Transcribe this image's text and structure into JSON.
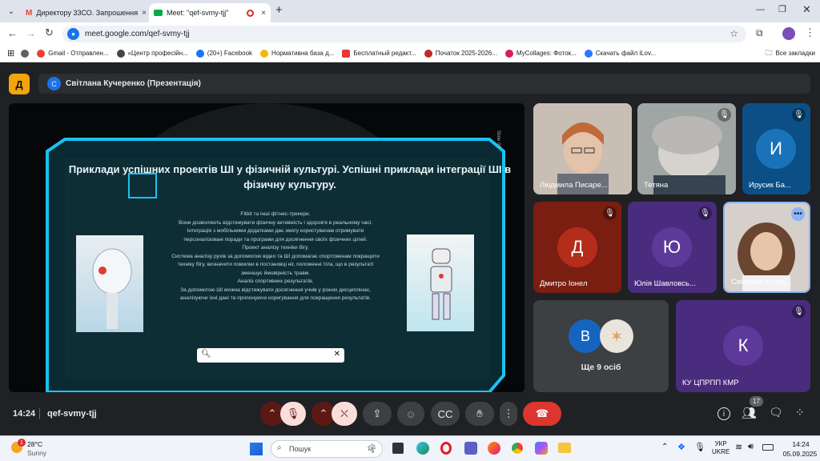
{
  "browser": {
    "tabs": [
      {
        "label": "Директору 33СО. Запрошення",
        "icon": "gmail-icon"
      },
      {
        "label": "Meet: \"qef-svmy-tjj\"",
        "icon": "meet-icon"
      }
    ],
    "new_tab": "+",
    "url": "meet.google.com/qef-svmy-tjj",
    "profile_initial": "K",
    "bookmarks": [
      {
        "label": "Gmail - Отправлен...",
        "color": "#ea4335"
      },
      {
        "label": "«Центр професійн...",
        "color": "#444444"
      },
      {
        "label": "(20+) Facebook",
        "color": "#1877f2"
      },
      {
        "label": "Нормативна база д...",
        "color": "#f2b90c"
      },
      {
        "label": "Бесплатный редакт...",
        "color": "#e53935"
      },
      {
        "label": "Початок 2025-2026...",
        "color": "#c62828"
      },
      {
        "label": "MyCollages: Фоток...",
        "color": "#d81b60"
      },
      {
        "label": "Скачать файл iLov...",
        "color": "#2979ff"
      }
    ],
    "all_bookmarks": "Все закладки"
  },
  "meet": {
    "logo_letter": "Д",
    "presenter_initial": "С",
    "presenter_title": "Світлана Кучеренко (Презентація)",
    "time": "14:24",
    "code": "qef-svmy-tjj",
    "people_count": "17",
    "colors": {
      "hangup": "#dc362e",
      "muted": "#f9dedc",
      "accent": "#8ab4f8"
    }
  },
  "slide": {
    "side_label": "Slide 08",
    "title": "Приклади успішних проектів ШІ у фізичній культурі. Успішні приклади інтеграції ШІ в фізичну культуру.",
    "paragraphs": [
      "Fitbit та інші фітнес-трекери.",
      "Вони дозволяють відстежувати фізичну активність і здоров'я в реальному часі. Інтеграція з мобільними додатками дає змогу користувачам отримувати персоналізовані поради та програми для досягнення своїх фізичних цілей.",
      "Проект аналізу техніки бігу.",
      "Система аналізу рухів за допомогою відео та ШІ допомагає спортсменам покращити техніку бігу, визначити помилки в постановці ніг, положенні тіла, що в результаті зменшує ймовірність травм.",
      "Аналіз спортивних результатів.",
      "За допомогою ШІ можна відстежувати досягнення учнів у різних дисциплінах, аналізуючи їхні дані та пропонуючи коригування для покращення результатів."
    ]
  },
  "participants": [
    {
      "name": "Людмила Писаре...",
      "type": "video",
      "muted": false,
      "bg": "#b7a79a"
    },
    {
      "name": "Тетяна",
      "type": "video",
      "muted": true,
      "bg": "#8d8f8f"
    },
    {
      "name": "Ирусик Ба...",
      "initial": "И",
      "type": "avatar",
      "muted": true,
      "bg": "#0b4f86",
      "avatar": "#1a73b8"
    },
    {
      "name": "Дмитро Іонел",
      "initial": "Д",
      "type": "avatar",
      "muted": true,
      "bg": "#7a1e12",
      "avatar": "#b32d1a"
    },
    {
      "name": "Юлія Шавловсь...",
      "initial": "Ю",
      "type": "avatar",
      "muted": true,
      "bg": "#4a2c7e",
      "avatar": "#5d3a99"
    },
    {
      "name": "Світлана Кучер...",
      "type": "video",
      "muted": false,
      "bg": "#c9c4c0"
    }
  ],
  "others": {
    "label": "Ще 9 осіб",
    "initial": "В"
  },
  "last_tile": {
    "name": "КУ ЦПРПП КМР",
    "initial": "К"
  },
  "taskbar": {
    "temp": "28°C",
    "weather": "Sunny",
    "search_placeholder": "Пошук",
    "lang_top": "УКР",
    "lang_bottom": "UKRE",
    "clock_time": "14:24",
    "clock_date": "05.09.2025",
    "notif_badge": "1"
  }
}
